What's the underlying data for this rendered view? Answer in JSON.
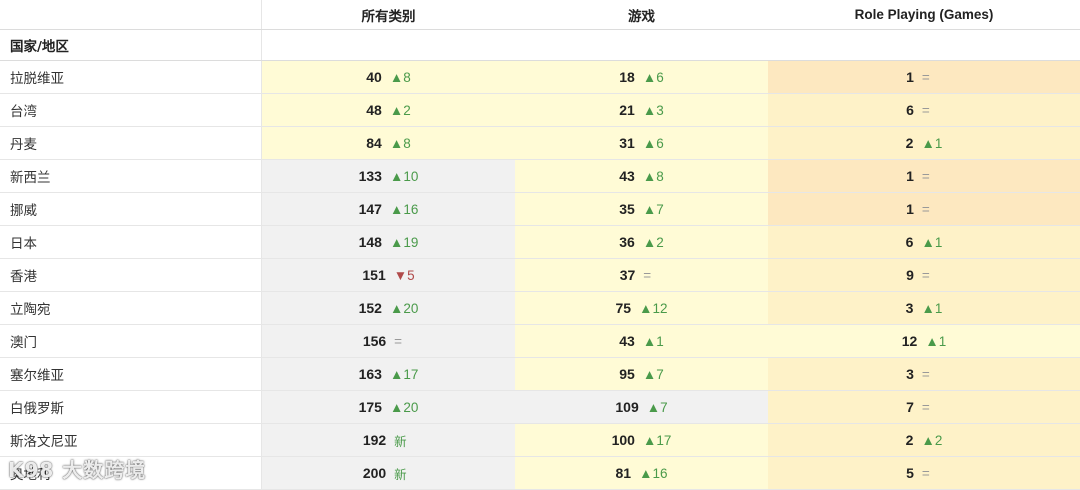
{
  "headers": {
    "country": "",
    "col1": "所有类别",
    "col2": "游戏",
    "col3": "Role Playing (Games)"
  },
  "subheader": "国家/地区",
  "symbols": {
    "up": "▲",
    "down": "▼",
    "same": "="
  },
  "rows": [
    {
      "country": "拉脱维亚",
      "c1": {
        "rank": "40",
        "dir": "up",
        "chg": "8",
        "bg": "yellow"
      },
      "c2": {
        "rank": "18",
        "dir": "up",
        "chg": "6",
        "bg": "yellow"
      },
      "c3": {
        "rank": "1",
        "dir": "same",
        "chg": "",
        "bg": "orange"
      }
    },
    {
      "country": "台湾",
      "c1": {
        "rank": "48",
        "dir": "up",
        "chg": "2",
        "bg": "yellow"
      },
      "c2": {
        "rank": "21",
        "dir": "up",
        "chg": "3",
        "bg": "yellow"
      },
      "c3": {
        "rank": "6",
        "dir": "same",
        "chg": "",
        "bg": "lightorange"
      }
    },
    {
      "country": "丹麦",
      "c1": {
        "rank": "84",
        "dir": "up",
        "chg": "8",
        "bg": "yellow"
      },
      "c2": {
        "rank": "31",
        "dir": "up",
        "chg": "6",
        "bg": "yellow"
      },
      "c3": {
        "rank": "2",
        "dir": "up",
        "chg": "1",
        "bg": "lightorange"
      }
    },
    {
      "country": "新西兰",
      "c1": {
        "rank": "133",
        "dir": "up",
        "chg": "10",
        "bg": "gray"
      },
      "c2": {
        "rank": "43",
        "dir": "up",
        "chg": "8",
        "bg": "yellow"
      },
      "c3": {
        "rank": "1",
        "dir": "same",
        "chg": "",
        "bg": "orange"
      }
    },
    {
      "country": "挪威",
      "c1": {
        "rank": "147",
        "dir": "up",
        "chg": "16",
        "bg": "gray"
      },
      "c2": {
        "rank": "35",
        "dir": "up",
        "chg": "7",
        "bg": "yellow"
      },
      "c3": {
        "rank": "1",
        "dir": "same",
        "chg": "",
        "bg": "orange"
      }
    },
    {
      "country": "日本",
      "c1": {
        "rank": "148",
        "dir": "up",
        "chg": "19",
        "bg": "gray"
      },
      "c2": {
        "rank": "36",
        "dir": "up",
        "chg": "2",
        "bg": "yellow"
      },
      "c3": {
        "rank": "6",
        "dir": "up",
        "chg": "1",
        "bg": "lightorange"
      }
    },
    {
      "country": "香港",
      "c1": {
        "rank": "151",
        "dir": "down",
        "chg": "5",
        "bg": "gray"
      },
      "c2": {
        "rank": "37",
        "dir": "same",
        "chg": "",
        "bg": "yellow"
      },
      "c3": {
        "rank": "9",
        "dir": "same",
        "chg": "",
        "bg": "lightorange"
      }
    },
    {
      "country": "立陶宛",
      "c1": {
        "rank": "152",
        "dir": "up",
        "chg": "20",
        "bg": "gray"
      },
      "c2": {
        "rank": "75",
        "dir": "up",
        "chg": "12",
        "bg": "yellow"
      },
      "c3": {
        "rank": "3",
        "dir": "up",
        "chg": "1",
        "bg": "lightorange"
      }
    },
    {
      "country": "澳门",
      "c1": {
        "rank": "156",
        "dir": "same",
        "chg": "",
        "bg": "gray"
      },
      "c2": {
        "rank": "43",
        "dir": "up",
        "chg": "1",
        "bg": "yellow"
      },
      "c3": {
        "rank": "12",
        "dir": "up",
        "chg": "1",
        "bg": "yellow"
      }
    },
    {
      "country": "塞尔维亚",
      "c1": {
        "rank": "163",
        "dir": "up",
        "chg": "17",
        "bg": "gray"
      },
      "c2": {
        "rank": "95",
        "dir": "up",
        "chg": "7",
        "bg": "yellow"
      },
      "c3": {
        "rank": "3",
        "dir": "same",
        "chg": "",
        "bg": "lightorange"
      }
    },
    {
      "country": "白俄罗斯",
      "c1": {
        "rank": "175",
        "dir": "up",
        "chg": "20",
        "bg": "gray"
      },
      "c2": {
        "rank": "109",
        "dir": "up",
        "chg": "7",
        "bg": "gray"
      },
      "c3": {
        "rank": "7",
        "dir": "same",
        "chg": "",
        "bg": "lightorange"
      }
    },
    {
      "country": "斯洛文尼亚",
      "c1": {
        "rank": "192",
        "dir": "new",
        "chg": "新",
        "bg": "gray"
      },
      "c2": {
        "rank": "100",
        "dir": "up",
        "chg": "17",
        "bg": "yellow"
      },
      "c3": {
        "rank": "2",
        "dir": "up",
        "chg": "2",
        "bg": "lightorange"
      }
    },
    {
      "country": "奥地利",
      "c1": {
        "rank": "200",
        "dir": "new",
        "chg": "新",
        "bg": "gray"
      },
      "c2": {
        "rank": "81",
        "dir": "up",
        "chg": "16",
        "bg": "yellow"
      },
      "c3": {
        "rank": "5",
        "dir": "same",
        "chg": "",
        "bg": "lightorange"
      }
    }
  ],
  "watermark": "K98 大数跨境",
  "colors": {
    "yellow": "#fffbd6",
    "orange": "#fde8c0",
    "lightorange": "#fef2c8",
    "gray": "#f1f1f1",
    "up": "#4a9a4a",
    "down": "#b04a4a"
  }
}
